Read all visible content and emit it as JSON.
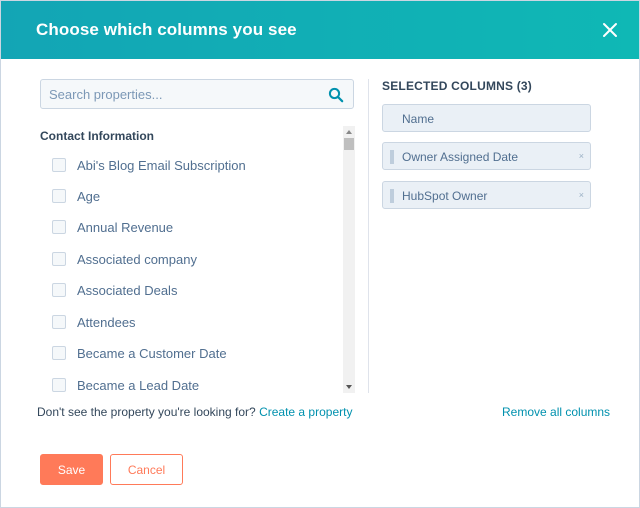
{
  "header": {
    "title": "Choose which columns you see",
    "close_icon": "close-icon"
  },
  "search": {
    "placeholder": "Search properties...",
    "value": "",
    "icon": "search-icon"
  },
  "properties": {
    "group_label": "Contact Information",
    "items": [
      {
        "label": "Abi's Blog Email Subscription",
        "checked": false
      },
      {
        "label": "Age",
        "checked": false
      },
      {
        "label": "Annual Revenue",
        "checked": false
      },
      {
        "label": "Associated company",
        "checked": false
      },
      {
        "label": "Associated Deals",
        "checked": false
      },
      {
        "label": "Attendees",
        "checked": false
      },
      {
        "label": "Became a Customer Date",
        "checked": false
      },
      {
        "label": "Became a Lead Date",
        "checked": false
      }
    ]
  },
  "selected": {
    "title": "SELECTED COLUMNS (3)",
    "columns": [
      {
        "label": "Name",
        "removable": false
      },
      {
        "label": "Owner Assigned Date",
        "removable": true
      },
      {
        "label": "HubSpot Owner",
        "removable": true
      }
    ],
    "remove_glyph": "×"
  },
  "footer": {
    "hint_text": "Don't see the property you're looking for?",
    "create_link": "Create a property",
    "remove_all": "Remove all columns",
    "save_label": "Save",
    "cancel_label": "Cancel"
  },
  "colors": {
    "header_teal": "#13a5b5",
    "accent_orange": "#ff7a59",
    "link_teal": "#0091ae"
  }
}
